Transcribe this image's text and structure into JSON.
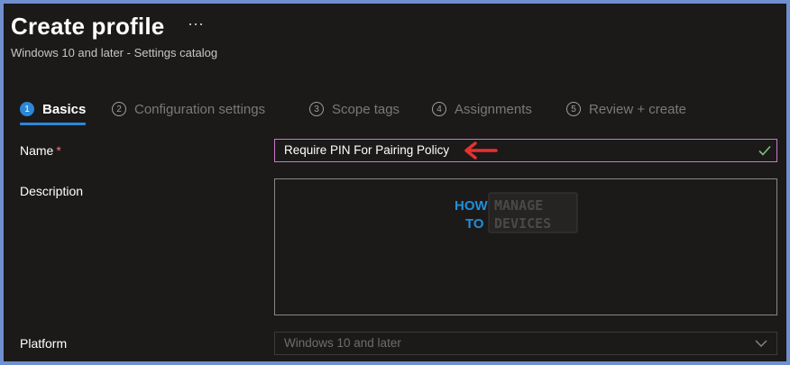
{
  "header": {
    "title": "Create profile",
    "more_label": "···",
    "subtitle": "Windows 10 and later - Settings catalog"
  },
  "steps": [
    {
      "num": "1",
      "label": "Basics",
      "active": true
    },
    {
      "num": "2",
      "label": "Configuration settings",
      "active": false
    },
    {
      "num": "3",
      "label": "Scope tags",
      "active": false
    },
    {
      "num": "4",
      "label": "Assignments",
      "active": false
    },
    {
      "num": "5",
      "label": "Review + create",
      "active": false
    }
  ],
  "form": {
    "name": {
      "label": "Name",
      "required_mark": "*",
      "value": "Require PIN For Pairing Policy"
    },
    "description": {
      "label": "Description",
      "value": ""
    },
    "platform": {
      "label": "Platform",
      "value": "Windows 10 and later"
    }
  },
  "watermark": {
    "line1_left": "HOW",
    "line1_right": "MANAGE",
    "line2_left": "TO",
    "line2_right": "DEVICES"
  },
  "colors": {
    "accent": "#2b88d8",
    "required": "#f1707b",
    "valid_check": "#7ec27a",
    "annotation_arrow": "#e8312f",
    "focus_border": "#c878c8"
  }
}
